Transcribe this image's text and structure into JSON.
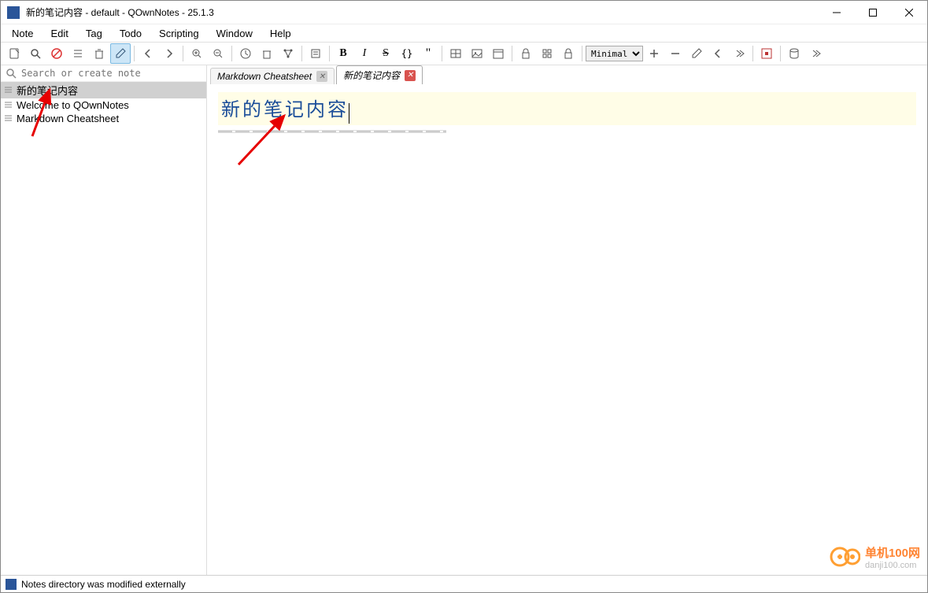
{
  "window": {
    "title": "新的笔记内容 - default - QOwnNotes - 25.1.3"
  },
  "menu": {
    "items": [
      "Note",
      "Edit",
      "Tag",
      "Todo",
      "Scripting",
      "Window",
      "Help"
    ]
  },
  "toolbar": {
    "format_select": "Minimal"
  },
  "sidebar": {
    "search_placeholder": "Search or create note",
    "notes": [
      {
        "label": "新的笔记内容",
        "selected": true
      },
      {
        "label": "Welcome to QOwnNotes",
        "selected": false
      },
      {
        "label": "Markdown Cheatsheet",
        "selected": false
      }
    ]
  },
  "tabs": [
    {
      "label": "Markdown Cheatsheet",
      "active": false,
      "close_style": "gray"
    },
    {
      "label": "新的笔记内容",
      "active": true,
      "close_style": "red"
    }
  ],
  "editor": {
    "heading": "新的笔记内容"
  },
  "statusbar": {
    "message": "Notes directory was modified externally"
  },
  "watermark": {
    "line1": "单机100网",
    "line2": "danji100.com"
  }
}
